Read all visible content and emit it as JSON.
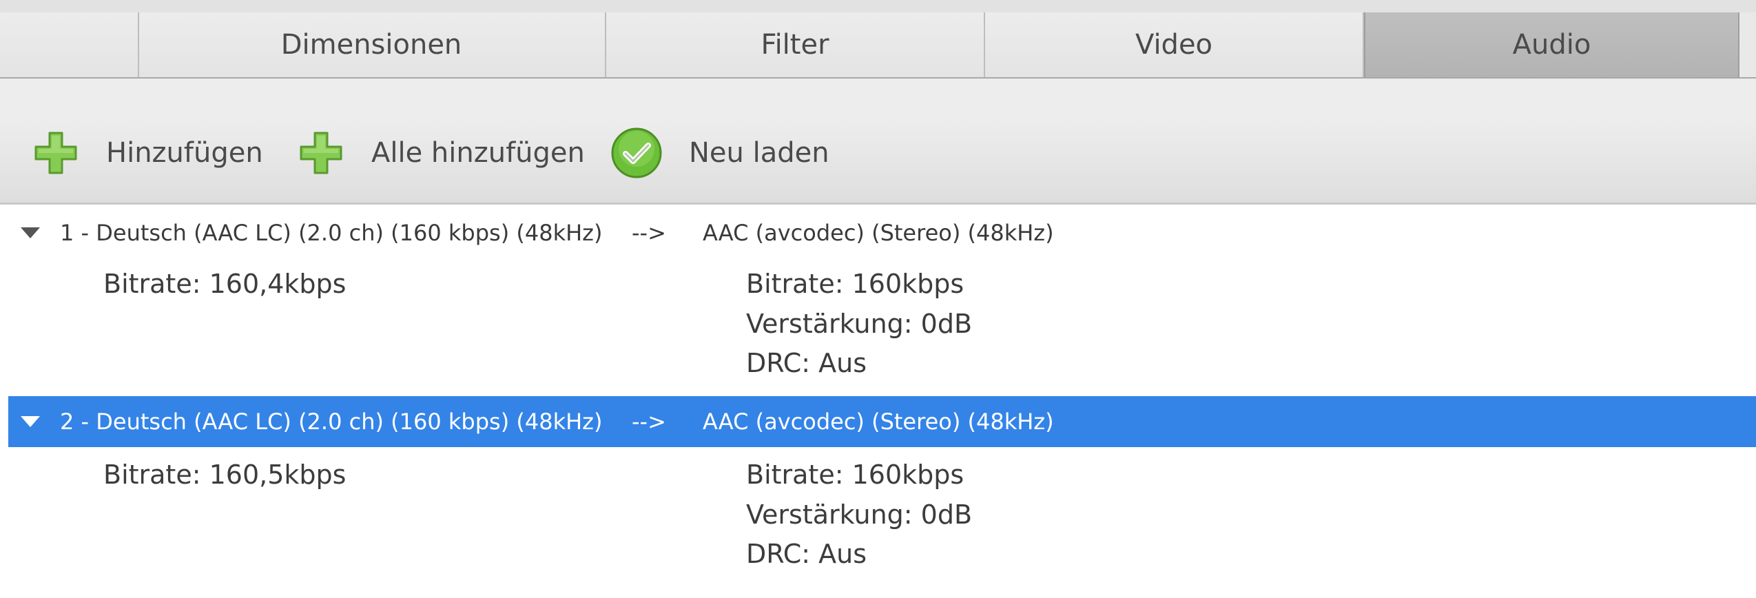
{
  "tabs": [
    {
      "label": "Dimensionen",
      "active": false
    },
    {
      "label": "Filter",
      "active": false
    },
    {
      "label": "Video",
      "active": false
    },
    {
      "label": "Audio",
      "active": true
    }
  ],
  "toolbar": {
    "add_label": "Hinzufügen",
    "add_all_label": "Alle hinzufügen",
    "reload_label": "Neu laden"
  },
  "colors": {
    "selection": "#3484e8",
    "plus_green": "#7fc64a",
    "check_green": "#63b52f"
  },
  "tracks": [
    {
      "source": "1 - Deutsch (AAC LC) (2.0 ch) (160 kbps) (48kHz)",
      "arrow": "-->",
      "target": "AAC (avcodec) (Stereo) (48kHz)",
      "source_bitrate": "Bitrate: 160,4kbps",
      "target_bitrate": "Bitrate: 160kbps",
      "gain": "Verstärkung: 0dB",
      "drc": "DRC: Aus",
      "selected": false
    },
    {
      "source": "2 - Deutsch (AAC LC) (2.0 ch) (160 kbps) (48kHz)",
      "arrow": "-->",
      "target": "AAC (avcodec) (Stereo) (48kHz)",
      "source_bitrate": "Bitrate: 160,5kbps",
      "target_bitrate": "Bitrate: 160kbps",
      "gain": "Verstärkung: 0dB",
      "drc": "DRC: Aus",
      "selected": true
    }
  ]
}
